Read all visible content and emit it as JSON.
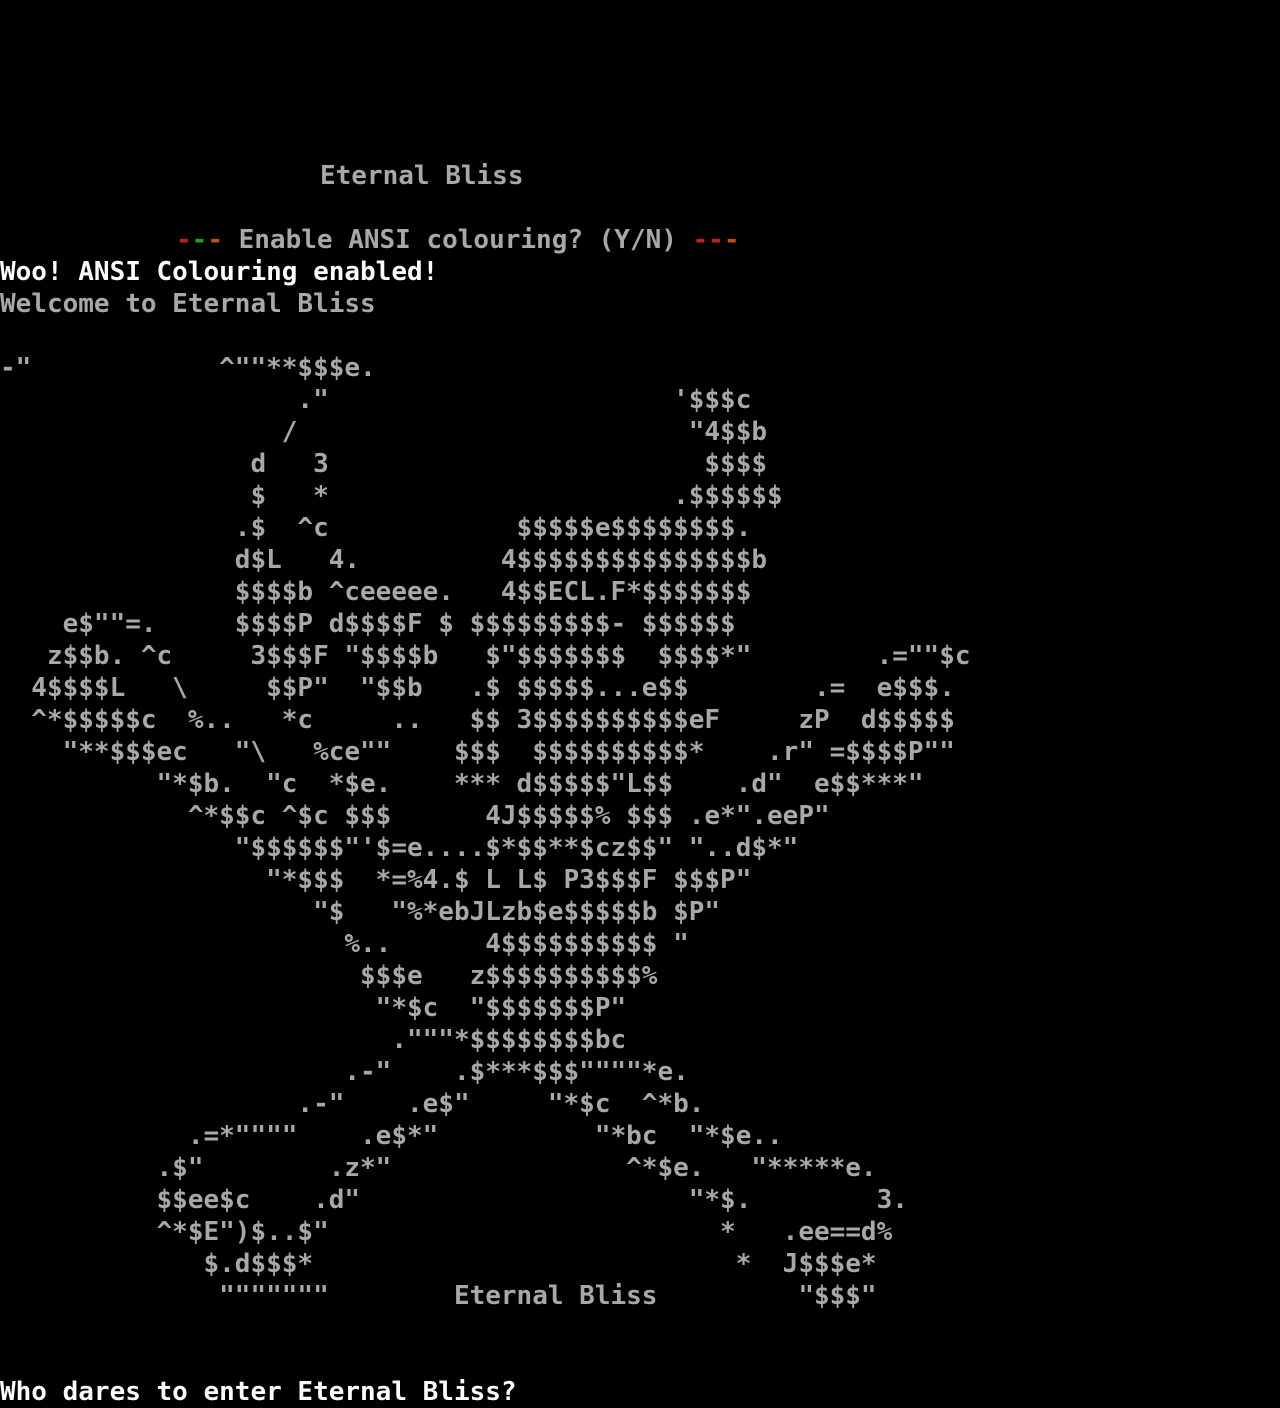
{
  "terminal": {
    "title_line": "Eternal Bliss",
    "ansi_prompt": {
      "dash_left_1": "-",
      "dash_left_2": "-",
      "dash_left_3": "-",
      "text": " Enable ANSI colouring? (Y/N) ",
      "dash_right_1": "-",
      "dash_right_2": "-",
      "dash_right_3": "-"
    },
    "ansi_enabled": "Woo! ANSI Colouring enabled!",
    "welcome": "Welcome to Eternal Bliss",
    "ascii_art": "-\"            ^\"\"**$$$e.\n                   .\"                      '$$$c\n                  /                         \"4$$b\n                d   3                        $$$$\n                $   *                      .$$$$$$\n               .$  ^c            $$$$$e$$$$$$$$.\n               d$L   4.         4$$$$$$$$$$$$$$$b\n               $$$$b ^ceeeee.   4$$ECL.F*$$$$$$$\n    e$\"\"=.     $$$$P d$$$$F $ $$$$$$$$$- $$$$$$\n   z$$b. ^c     3$$$F \"$$$$b   $\"$$$$$$$  $$$$*\"        .=\"\"$c\n  4$$$$L   \\     $$P\"  \"$$b   .$ $$$$$...e$$        .=  e$$$.\n  ^*$$$$$c  %..   *c     ..   $$ 3$$$$$$$$$$eF     zP  d$$$$$\n    \"**$$$ec   \"\\   %ce\"\"    $$$  $$$$$$$$$$*    .r\" =$$$$P\"\"\n          \"*$b.  \"c  *$e.    *** d$$$$$\"L$$    .d\"  e$$***\"\n            ^*$$c ^$c $$$      4J$$$$$% $$$ .e*\".eeP\"\n               \"$$$$$$\"'$=e....$*$$**$cz$$\" \"..d$*\"\n                 \"*$$$  *=%4.$ L L$ P3$$$F $$$P\"\n                    \"$   \"%*ebJLzb$e$$$$$b $P\"\n                      %..      4$$$$$$$$$$ \"\n                       $$$e   z$$$$$$$$$$%\n                        \"*$c  \"$$$$$$$P\"\n                         .\"\"\"*$$$$$$$$bc\n                      .-\"    .$***$$$\"\"\"\"*e.\n                   .-\"    .e$\"     \"*$c  ^*b.\n            .=*\"\"\"\"    .e$*\"          \"*bc  \"*$e..\n          .$\"        .z*\"               ^*$e.   \"*****e.\n          $$ee$c    .d\"                     \"*$.        3.\n          ^*$E\")$..$\"                         *   .ee==d%\n             $.d$$$*                           *  J$$$e*\n              \"\"\"\"\"\"\"        Eternal Bliss         \"$$$\"",
    "login_prompt": "Who dares to enter Eternal Bliss?"
  }
}
